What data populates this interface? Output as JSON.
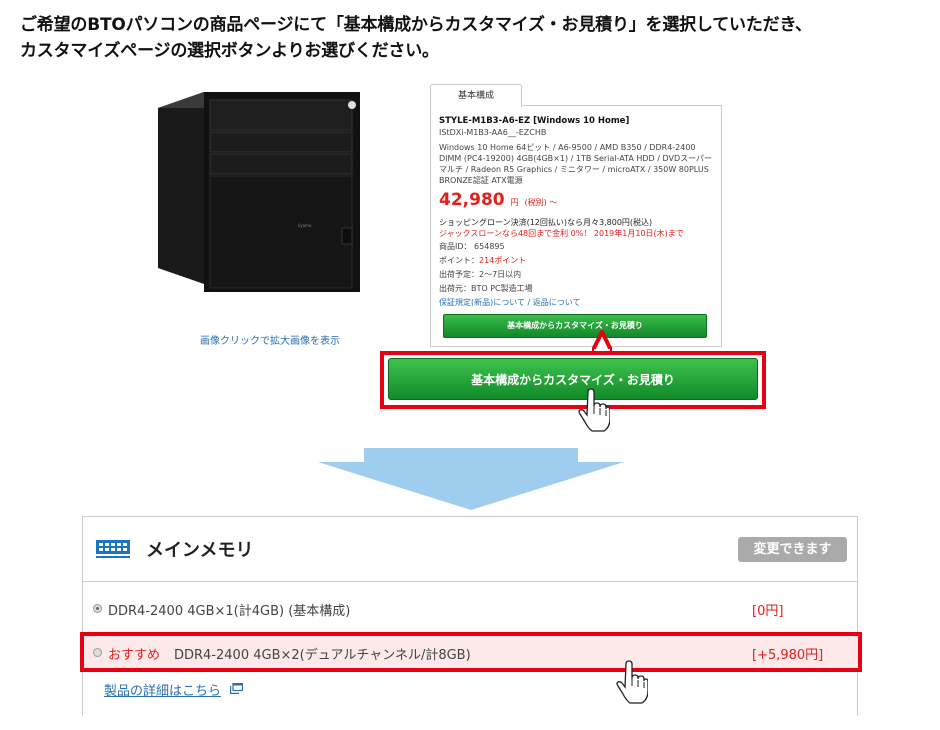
{
  "instruction": {
    "line1": "ご希望のBTOパソコンの商品ページにて「基本構成からカスタマイズ・お見積り」を選択していただき、",
    "line2": "カスタマイズページの選択ボタンよりお選びください。"
  },
  "product_image": {
    "brand_mark": "iiyama",
    "caption": "画像クリックで拡大画像を表示"
  },
  "product_panel": {
    "tab_label": "基本構成",
    "title": "STYLE-M1B3-A6-EZ [Windows 10 Home]",
    "code": "IStDXi-M1B3-AA6__-EZCHB",
    "spec": "Windows 10 Home 64ビット / A6-9500 / AMD B350 / DDR4-2400 DIMM (PC4-19200) 4GB(4GB×1) / 1TB Serial-ATA HDD / DVDスーパーマルチ / Radeon R5 Graphics / ミニタワー / microATX / 350W 80PLUS BRONZE認証 ATX電源",
    "price": "42,980",
    "price_unit": "円",
    "price_note": "(税別) ～",
    "loan_line1": "ショッピングローン決済(12回払い)なら月々3,800円(税込)",
    "loan_line2": "ジャックスローンなら48回まで金利 0%！ 2019年1月10日(木)まで",
    "product_id": "商品ID： 654895",
    "point_label": "ポイント：",
    "point_value": "214ポイント",
    "ship": "出荷予定：2～7日以内",
    "ship_from": "出荷元：BTO PC製造工場",
    "links": "保証規定(新品)について / 返品について",
    "button_label": "基本構成からカスタマイズ・お見積り"
  },
  "callout": {
    "button_label": "基本構成からカスタマイズ・お見積り"
  },
  "memory_section": {
    "title": "メインメモリ",
    "badge": "変更できます",
    "options": [
      {
        "label": "DDR4-2400 4GB×1(計4GB) (基本構成)",
        "price": "[0円]",
        "selected": true
      },
      {
        "recommend": "おすすめ",
        "label": "DDR4-2400 4GB×2(デュアルチャンネル/計8GB)",
        "price": "[+5,980円]",
        "selected": false
      }
    ],
    "detail_link": "製品の詳細はこちら"
  },
  "colors": {
    "accent_red": "#e60012",
    "button_green": "#1ea334",
    "link_blue": "#2a6fb0",
    "arrow_blue": "#9fcdf0"
  }
}
